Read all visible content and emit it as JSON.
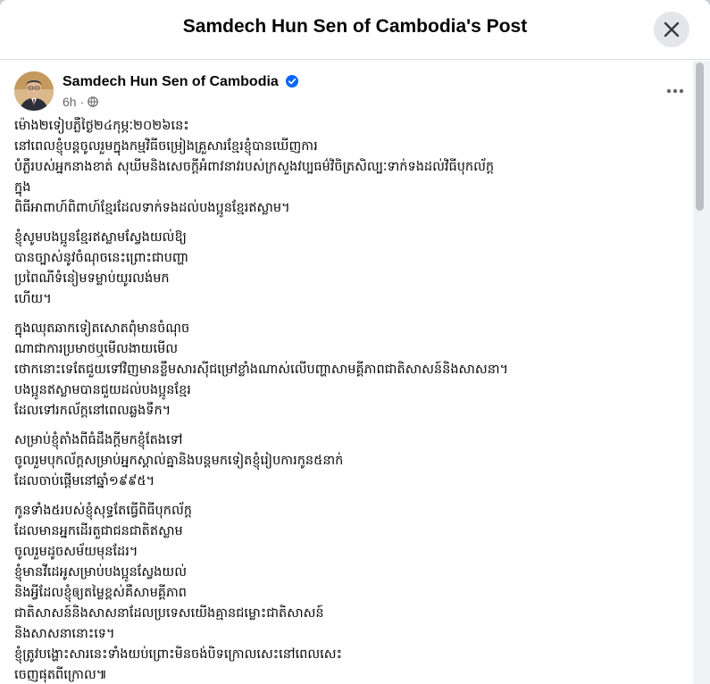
{
  "dialog": {
    "title": "Samdech Hun Sen of Cambodia's Post"
  },
  "post": {
    "author": "Samdech Hun Sen of Cambodia",
    "time": "6h",
    "paragraphs": [
      [
        "ម៉ោង២ទៀបភ្លឺថ្ងៃ២៤កុម្ភៈ២០២៦នេះ",
        "នៅពេលខ្ញុំបន្តចូលរួមក្នុងកម្មវិធីចម្រៀងគ្រួសារខ្មែរខ្ញុំបានឃើញការ",
        "បំភ្លឺរបស់អ្នកនាងខាត់ សុឃីមនិងសេចក្តីអំពាវនាវរបស់ក្រសួងវប្បធម៌វិចិត្រសិល្បៈទាក់ទងដល់វិធីបុកល័ក្ត",
        "ក្នុង",
        "ពិធីអាពាហ៍ពិពាហ៍ខ្មែរដែលទាក់ទងដល់បងប្អូនខ្មែរឥស្លាម។"
      ],
      [
        "ខ្ញុំសូមបងប្អូនខ្មែរឥស្លាមស្វែងយល់ឱ្យ",
        "បានច្បាស់នូវចំណុចនេះព្រោះជាបញ្ហា",
        "ប្រពៃណីទំនៀមទម្លាប់យូរលង់មក",
        "ហើយ។"
      ],
      [
        "ក្នុងឈុតឆាកទៀតសោតពុំមានចំណុច",
        "ណាជាការប្រមាថឬមើលងាយមើល",
        "ថោកនោះទេតែជួយទៅវិញមានខ្លឹមសារស៊ីជម្រៅខ្លាំងណាស់លើបញ្ហាសាមគ្គីភាពជាតិសាសន៍និងសាសនា។",
        "បងប្អូនឥស្លាមបានជួយដល់បងប្អូនខ្មែរ",
        "ដែលទៅរកល័ក្តនៅពេលឆ្លងទឹក។"
      ],
      [
        "សម្រាប់ខ្ញុំតាំងពីធំដឹងក្តីមកខ្ញុំតែងទៅ",
        "ចូលរួមបុកល័ក្តសម្រាប់អ្នកស្គាល់គ្នានិងបន្តមកទៀតខ្ញុំរៀបការកូន៥នាក់",
        "ដែលចាប់ផ្តើមនៅឆ្នាំ១៩៩៥។"
      ],
      [
        "កូនទាំង៥របស់ខ្ញុំសុទ្ធតែធ្វើពិធីបុកល័ក្ត",
        "ដែលមានអ្នកដើរតួជាជនជាតិឥស្លាម",
        "ចូលរួមដូចសម័យមុនដែរ។",
        "ខ្ញុំមានវីដេអូសម្រាប់បងប្អូនស្វែងយល់",
        "និងអ្វីដែលខ្ញុំឲ្យតម្លៃខ្ពស់គឺសាមគ្គីភាព",
        "ជាតិសាសន៍និងសាសនាដែលប្រទេសយើងគ្មានជម្លោះជាតិសាសន៍",
        "និងសាសនានោះទេ។",
        "ខ្ញុំត្រូវបង្ហោះសារនេះទាំងយប់ព្រោះមិនចង់បិទក្រោលសេះនៅពេលសេះ",
        "ចេញផុតពីក្រោល៕"
      ]
    ]
  },
  "icons": {
    "close": "close-icon",
    "verified": "verified-badge-icon",
    "privacy": "globe-icon",
    "more": "more-options-icon"
  },
  "colors": {
    "accent": "#0866ff",
    "secondary_text": "#65676b",
    "divider": "#dadde1"
  }
}
